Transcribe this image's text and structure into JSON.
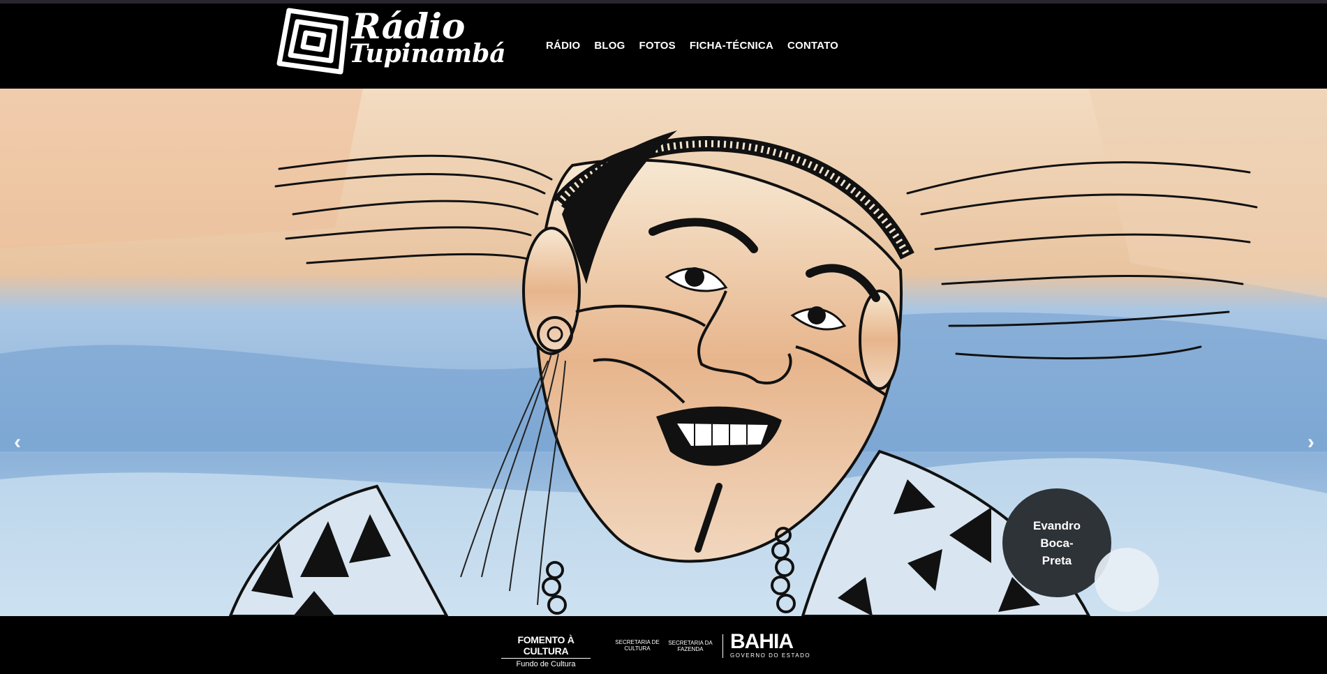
{
  "header": {
    "logo": {
      "line1": "Rádio",
      "line2": "Tupinambá"
    },
    "nav": [
      {
        "label": "RÁDIO"
      },
      {
        "label": "BLOG"
      },
      {
        "label": "FOTOS"
      },
      {
        "label": "FICHA-TÉCNICA"
      },
      {
        "label": "CONTATO"
      }
    ]
  },
  "hero": {
    "caption": "Evandro Boca-Preta",
    "prev_icon": "chevron-left-icon",
    "next_icon": "chevron-right-icon",
    "prev_glyph": "‹",
    "next_glyph": "›"
  },
  "footer": {
    "fomento_title": "FOMENTO À CULTURA",
    "fomento_sub": "Fundo de Cultura",
    "secult": "SECRETARIA DE CULTURA",
    "secfaz": "SECRETARIA DA FAZENDA",
    "bahia_title": "BAHIA",
    "bahia_sub": "GOVERNO DO ESTADO"
  },
  "colors": {
    "background": "#000000",
    "caption_bg": "#2e3338",
    "sky_blue": "#7ea6d2",
    "skin_orange": "#e0a173"
  }
}
